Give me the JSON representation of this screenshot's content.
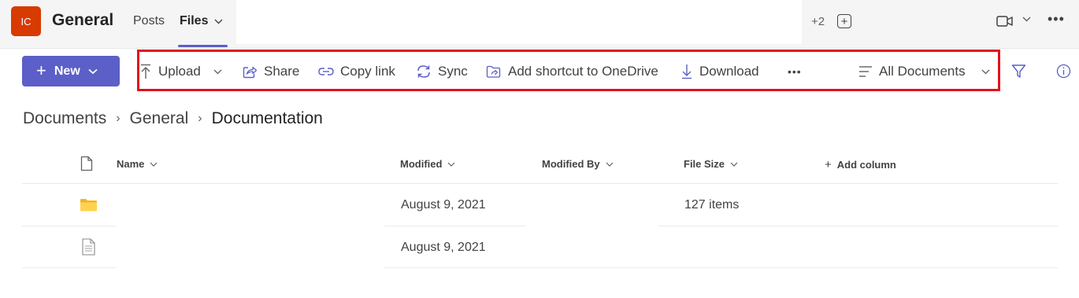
{
  "header": {
    "team_initials": "IC",
    "team_name": "General",
    "tabs": [
      {
        "label": "Posts",
        "active": false
      },
      {
        "label": "Files",
        "active": true
      }
    ],
    "more_tabs_count": "+2",
    "accent_color": "#5b5fc7",
    "avatar_color": "#d83b01"
  },
  "toolbar": {
    "new_label": "New",
    "upload_label": "Upload",
    "share_label": "Share",
    "copy_link_label": "Copy link",
    "sync_label": "Sync",
    "add_shortcut_label": "Add shortcut to OneDrive",
    "download_label": "Download",
    "view_label": "All Documents",
    "highlight_color": "#e3101e"
  },
  "breadcrumb": {
    "items": [
      "Documents",
      "General",
      "Documentation"
    ]
  },
  "table": {
    "columns": [
      "Name",
      "Modified",
      "Modified By",
      "File Size"
    ],
    "add_column_label": "Add column",
    "rows": [
      {
        "type": "folder",
        "name": "",
        "modified": "August 9, 2021",
        "modified_by": "",
        "file_size": "127 items"
      },
      {
        "type": "file",
        "name": "",
        "modified": "August 9, 2021",
        "modified_by": "",
        "file_size": ""
      }
    ]
  }
}
